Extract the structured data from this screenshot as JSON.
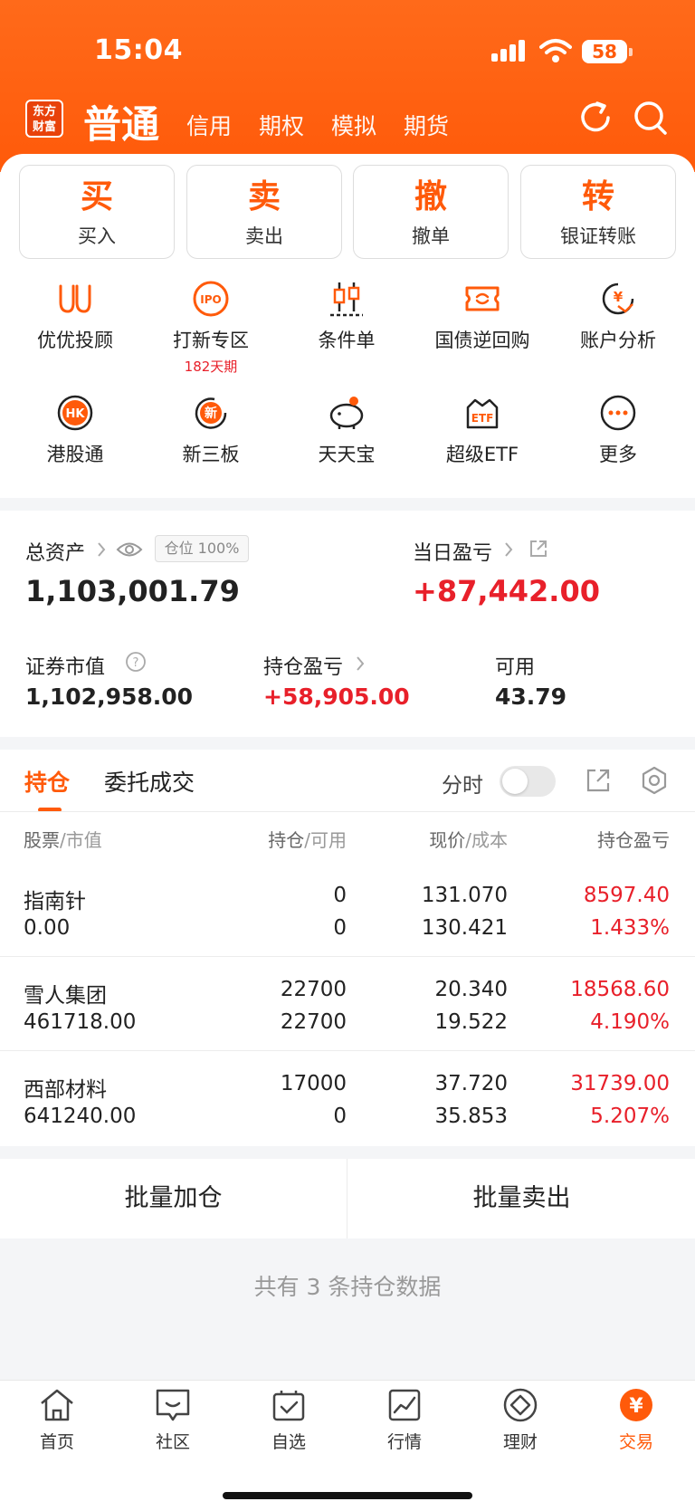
{
  "status_bar": {
    "time": "15:04",
    "battery": "58"
  },
  "header": {
    "logo_line1": "东方",
    "logo_line2": "财富",
    "tabs": [
      "普通",
      "信用",
      "期权",
      "模拟",
      "期货"
    ],
    "accent": "#ff5a0a"
  },
  "quick_actions": [
    {
      "big": "买",
      "label": "买入"
    },
    {
      "big": "卖",
      "label": "卖出"
    },
    {
      "big": "撤",
      "label": "撤单"
    },
    {
      "big": "转",
      "label": "银证转账"
    }
  ],
  "features": [
    {
      "label": "优优投顾",
      "icon": "youyou-icon"
    },
    {
      "label": "打新专区",
      "sub": "182天期",
      "icon": "ipo-icon",
      "icon_text": "IPO"
    },
    {
      "label": "条件单",
      "icon": "candlestick-icon"
    },
    {
      "label": "国债逆回购",
      "icon": "bond-repo-icon"
    },
    {
      "label": "账户分析",
      "icon": "account-analysis-icon",
      "icon_text": "¥"
    },
    {
      "label": "港股通",
      "icon": "hk-icon",
      "icon_text": "HK"
    },
    {
      "label": "新三板",
      "icon": "neeq-icon",
      "icon_text": "新"
    },
    {
      "label": "天天宝",
      "icon": "piggy-bank-icon"
    },
    {
      "label": "超级ETF",
      "icon": "etf-icon",
      "icon_text": "ETF"
    },
    {
      "label": "更多",
      "icon": "more-icon"
    }
  ],
  "assets": {
    "total_label": "总资产",
    "position_badge": "仓位 100%",
    "total_value": "1,103,001.79",
    "daily_pl_label": "当日盈亏",
    "daily_pl_value": "+87,442.00",
    "market_value_label": "证券市值",
    "market_value": "1,102,958.00",
    "holding_pl_label": "持仓盈亏",
    "holding_pl_value": "+58,905.00",
    "available_label": "可用",
    "available_value": "43.79"
  },
  "positions": {
    "tabs": [
      "持仓",
      "委托成交"
    ],
    "timeshare_label": "分时",
    "headers": {
      "stock": "股票",
      "stock_sub": "/市值",
      "qty": "持仓",
      "qty_sub": "/可用",
      "price": "现价",
      "price_sub": "/成本",
      "pl": "持仓盈亏"
    },
    "rows": [
      {
        "name": "指南针",
        "value": "0.00",
        "hold": "0",
        "avail": "0",
        "price": "131.070",
        "cost": "130.421",
        "pl": "8597.40",
        "pl_pct": "1.433%"
      },
      {
        "name": "雪人集团",
        "value": "461718.00",
        "hold": "22700",
        "avail": "22700",
        "price": "20.340",
        "cost": "19.522",
        "pl": "18568.60",
        "pl_pct": "4.190%"
      },
      {
        "name": "西部材料",
        "value": "641240.00",
        "hold": "17000",
        "avail": "0",
        "price": "37.720",
        "cost": "35.853",
        "pl": "31739.00",
        "pl_pct": "5.207%"
      }
    ],
    "batch_add": "批量加仓",
    "batch_sell": "批量卖出",
    "summary": "共有 3 条持仓数据"
  },
  "nav": [
    {
      "label": "首页",
      "icon": "home-icon"
    },
    {
      "label": "社区",
      "icon": "community-icon"
    },
    {
      "label": "自选",
      "icon": "watchlist-icon"
    },
    {
      "label": "行情",
      "icon": "market-icon"
    },
    {
      "label": "理财",
      "icon": "wealth-icon"
    },
    {
      "label": "交易",
      "icon": "trade-icon",
      "icon_text": "¥",
      "active": true
    }
  ]
}
